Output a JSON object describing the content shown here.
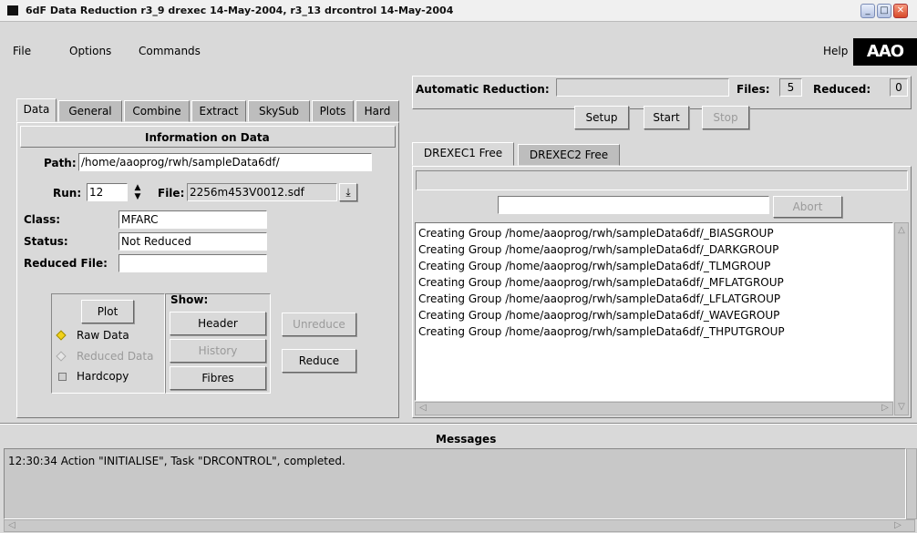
{
  "window": {
    "title": "6dF Data Reduction  r3_9 drexec 14-May-2004,  r3_13 drcontrol 14-May-2004"
  },
  "menu": {
    "file": "File",
    "options": "Options",
    "commands": "Commands",
    "help": "Help"
  },
  "logo": {
    "text": "AAO"
  },
  "tabs": [
    "Data",
    "General",
    "Combine",
    "Extract",
    "SkySub",
    "Plots",
    "Hard"
  ],
  "info": {
    "heading": "Information on Data",
    "path_label": "Path:",
    "path_value": "/home/aaoprog/rwh/sampleData6df/",
    "run_label": "Run:",
    "run_value": "12",
    "file_label": "File:",
    "file_value": "2256m453V0012.sdf",
    "class_label": "Class:",
    "class_value": "MFARC",
    "status_label": "Status:",
    "status_value": "Not Reduced",
    "reduced_label": "Reduced File:",
    "reduced_value": ""
  },
  "plot_box": {
    "plot_button": "Plot",
    "raw_data": "Raw Data",
    "reduced_data": "Reduced Data",
    "hardcopy": "Hardcopy",
    "show_label": "Show:",
    "header_button": "Header",
    "history_button": "History",
    "fibres_button": "Fibres"
  },
  "actions": {
    "unreduce": "Unreduce",
    "reduce": "Reduce"
  },
  "auto": {
    "label": "Automatic Reduction:",
    "value": "",
    "files_label": "Files:",
    "files_value": "5",
    "reduced_label": "Reduced:",
    "reduced_value": "0",
    "setup": "Setup",
    "start": "Start",
    "stop": "Stop"
  },
  "exec_tabs": [
    "DREXEC1 Free",
    "DREXEC2 Free"
  ],
  "exec": {
    "command_value": "",
    "abort": "Abort"
  },
  "log": [
    "Creating Group /home/aaoprog/rwh/sampleData6df/_BIASGROUP",
    "Creating Group /home/aaoprog/rwh/sampleData6df/_DARKGROUP",
    "Creating Group /home/aaoprog/rwh/sampleData6df/_TLMGROUP",
    "Creating Group /home/aaoprog/rwh/sampleData6df/_MFLATGROUP",
    "Creating Group /home/aaoprog/rwh/sampleData6df/_LFLATGROUP",
    "Creating Group /home/aaoprog/rwh/sampleData6df/_WAVEGROUP",
    "Creating Group /home/aaoprog/rwh/sampleData6df/_THPUTGROUP"
  ],
  "messages": {
    "heading": "Messages",
    "lines": [
      "12:30:34 Action \"INITIALISE\", Task \"DRCONTROL\", completed."
    ]
  },
  "icons": {
    "app": "app-icon",
    "minimize": "minimize-icon",
    "maximize": "maximize-icon",
    "close": "close-icon",
    "spinner": "spinner-icon",
    "file_dropdown": "download-arrow-icon",
    "scroll_up": "arrow-up-icon",
    "scroll_down": "arrow-down-icon",
    "scroll_left": "arrow-left-icon",
    "scroll_right": "arrow-right-icon"
  }
}
